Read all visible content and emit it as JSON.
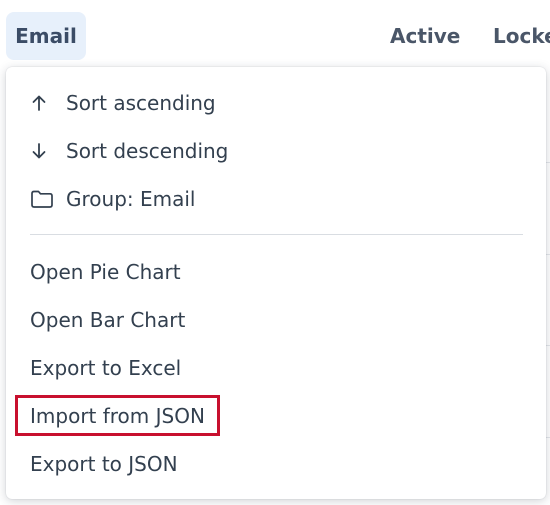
{
  "header": {
    "columns": [
      {
        "label": "Email"
      },
      {
        "label": "Active"
      },
      {
        "label": "Locked"
      }
    ]
  },
  "menu": {
    "sort_ascending": {
      "label": "Sort ascending",
      "icon": "arrow-up-icon"
    },
    "sort_descending": {
      "label": "Sort descending",
      "icon": "arrow-down-icon"
    },
    "group": {
      "label": "Group: Email",
      "icon": "folder-icon"
    },
    "open_pie_chart": {
      "label": "Open Pie Chart"
    },
    "open_bar_chart": {
      "label": "Open Bar Chart"
    },
    "export_excel": {
      "label": "Export to Excel"
    },
    "import_json": {
      "label": "Import from JSON"
    },
    "export_json": {
      "label": "Export to JSON"
    }
  },
  "colors": {
    "highlight": "#c8102e",
    "header_active_bg": "#e7f0fb"
  }
}
